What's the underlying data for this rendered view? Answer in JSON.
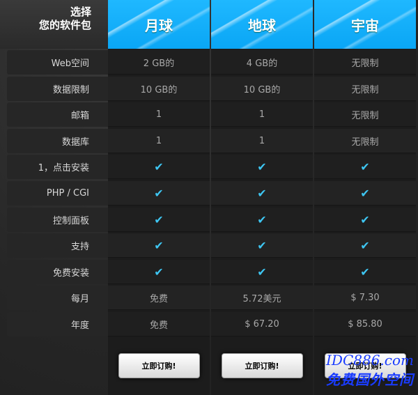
{
  "header": {
    "choose_line1": "选择",
    "choose_line2": "您的软件包"
  },
  "plans": [
    "月球",
    "地球",
    "宇宙"
  ],
  "rows": [
    {
      "label": "Web空间",
      "values": [
        "2 GB的",
        "4 GB的",
        "无限制"
      ]
    },
    {
      "label": "数据限制",
      "values": [
        "10 GB的",
        "10 GB的",
        "无限制"
      ]
    },
    {
      "label": "邮箱",
      "values": [
        "1",
        "1",
        "无限制"
      ]
    },
    {
      "label": "数据库",
      "values": [
        "1",
        "1",
        "无限制"
      ]
    },
    {
      "label": "1，点击安装",
      "values": [
        "✔",
        "✔",
        "✔"
      ]
    },
    {
      "label": "PHP / CGI",
      "values": [
        "✔",
        "✔",
        "✔"
      ]
    },
    {
      "label": "控制面板",
      "values": [
        "✔",
        "✔",
        "✔"
      ]
    },
    {
      "label": "支持",
      "values": [
        "✔",
        "✔",
        "✔"
      ]
    },
    {
      "label": "免费安装",
      "values": [
        "✔",
        "✔",
        "✔"
      ]
    },
    {
      "label": "每月",
      "values": [
        "免费",
        "5.72美元",
        "$ 7.30"
      ]
    },
    {
      "label": "年度",
      "values": [
        "免费",
        "$ 67.20",
        "$ 85.80"
      ]
    }
  ],
  "button_label": "立即订购!",
  "watermark": {
    "line1": "IDC886.com",
    "line2": "免费国外空间"
  },
  "colors": {
    "accent": "#0aa6f5",
    "check": "#3ec6f2"
  }
}
